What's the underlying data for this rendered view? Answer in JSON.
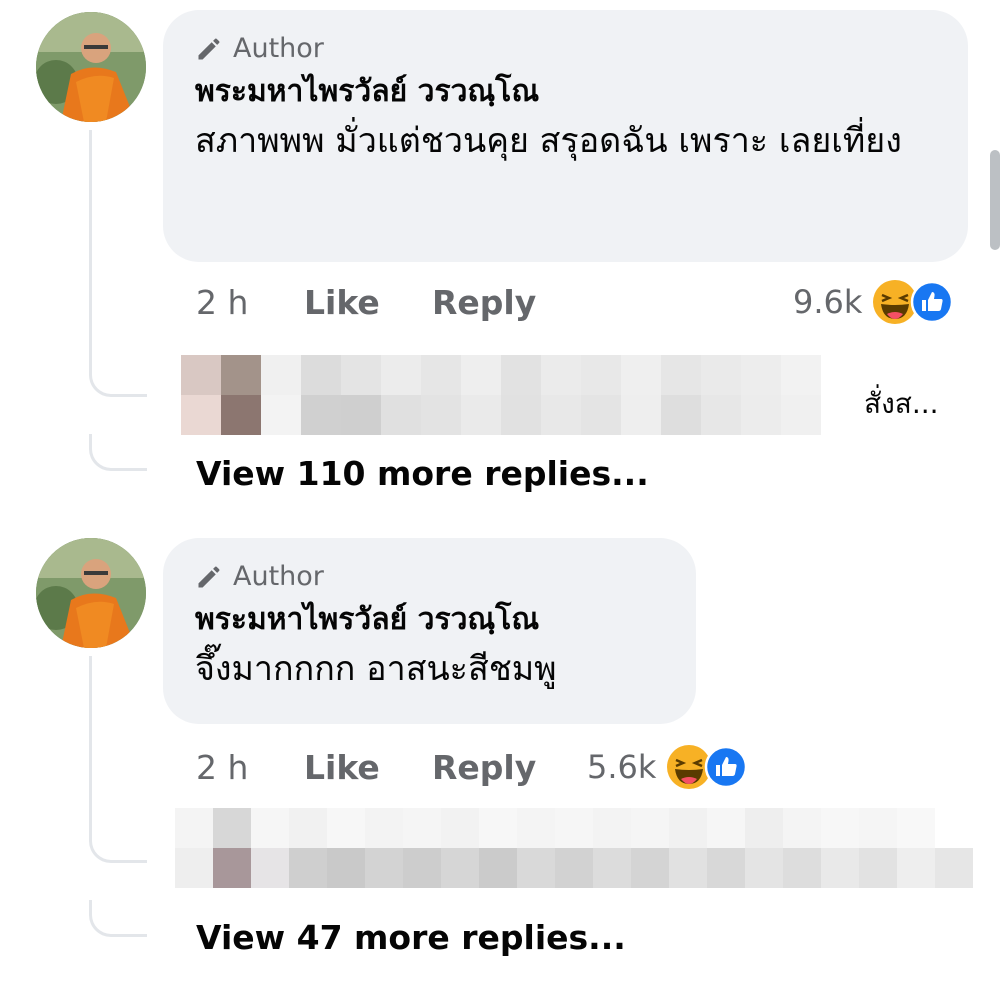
{
  "comments": [
    {
      "author_badge": "Author",
      "name": "พระมหาไพรวัลย์ วรวณฺโณ",
      "text": "สภาพพพ มั่วแต่ชวนคุย สรุอดฉัน เพราะ เลยเที่ยง",
      "time": "2 h",
      "like_label": "Like",
      "reply_label": "Reply",
      "reaction_count": "9.6k",
      "reactions": [
        "laugh-emoji",
        "like-icon"
      ],
      "reply_preview_trail": "สั่งส...",
      "view_more": "View 110 more replies..."
    },
    {
      "author_badge": "Author",
      "name": "พระมหาไพรวัลย์ วรวณฺโณ",
      "text": "จึ๊งมากกกก อาสนะสีชมพู",
      "time": "2 h",
      "like_label": "Like",
      "reply_label": "Reply",
      "reaction_count": "5.6k",
      "reactions": [
        "laugh-emoji",
        "like-icon"
      ],
      "reply_preview_trail": "",
      "view_more": "View 47 more replies..."
    }
  ],
  "colors": {
    "bubble": "#f0f2f5",
    "secondary_text": "#65676b",
    "like_blue": "#1877f2",
    "emoji_yellow": "#f7b125"
  }
}
